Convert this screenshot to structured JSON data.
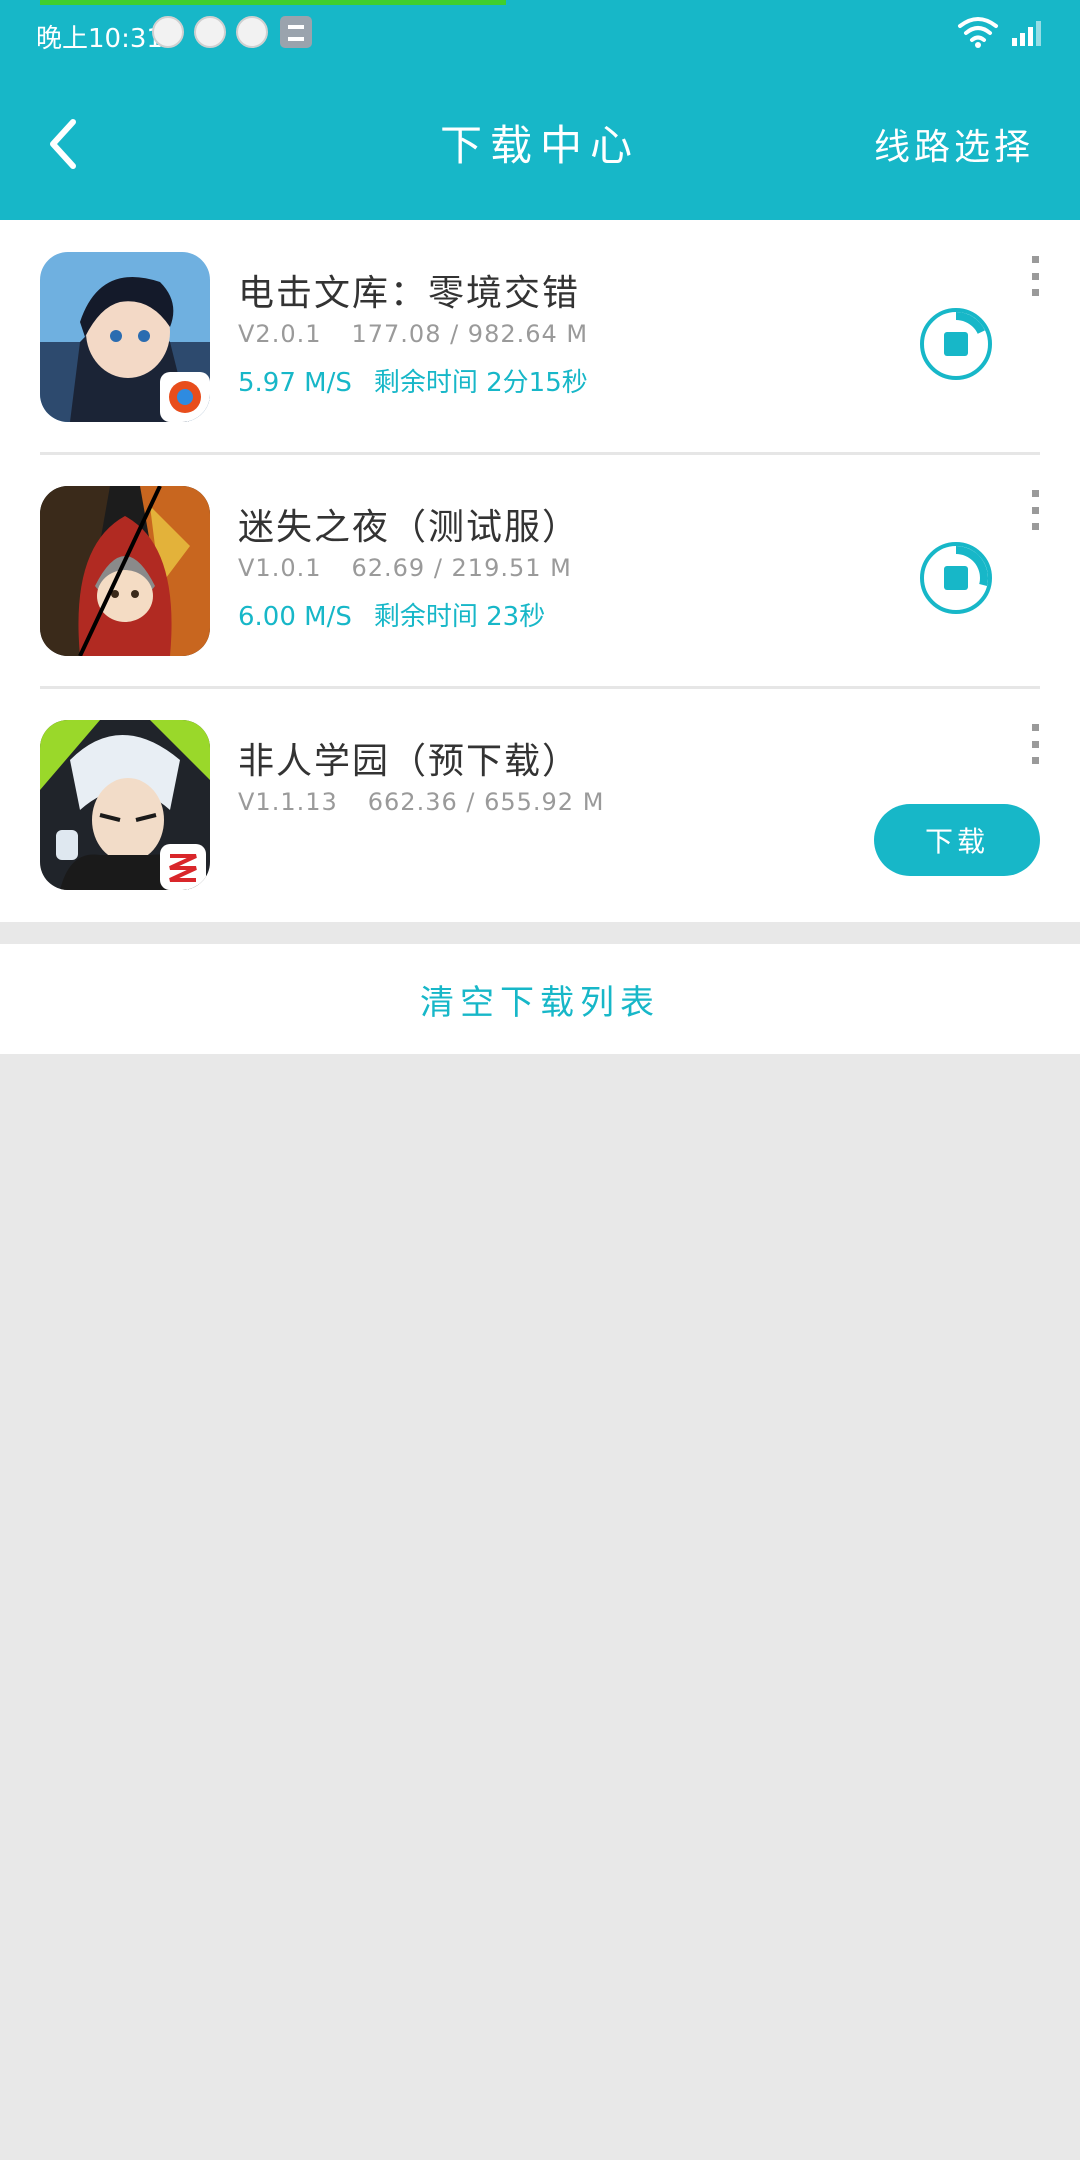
{
  "status_bar": {
    "time": "晚上10:31"
  },
  "header": {
    "title": "下载中心",
    "route_label": "线路选择"
  },
  "colors": {
    "accent": "#17b7c8",
    "progress_green": "#3fcf2d",
    "text_dark": "#333333",
    "text_gray": "#9a9a9a"
  },
  "downloads": [
    {
      "name": "电击文库：零境交错",
      "version": "V2.0.1",
      "progress_text": "177.08 / 982.64 M",
      "speed": "5.97 M/S",
      "remaining": "剩余时间 2分15秒",
      "state": "downloading",
      "progress_fraction": 0.18,
      "icon": "game-icon-sword-art"
    },
    {
      "name": "迷失之夜（测试服）",
      "version": "V1.0.1",
      "progress_text": "62.69 / 219.51 M",
      "speed": "6.00 M/S",
      "remaining": "剩余时间 23秒",
      "state": "downloading",
      "progress_fraction": 0.29,
      "icon": "game-icon-lost-night"
    },
    {
      "name": "非人学园（预下载）",
      "version": "V1.1.13",
      "progress_text": "662.36 / 655.92 M",
      "state": "paused",
      "action_label": "下载",
      "icon": "game-icon-feiren"
    }
  ],
  "footer": {
    "clear_label": "清空下载列表"
  }
}
